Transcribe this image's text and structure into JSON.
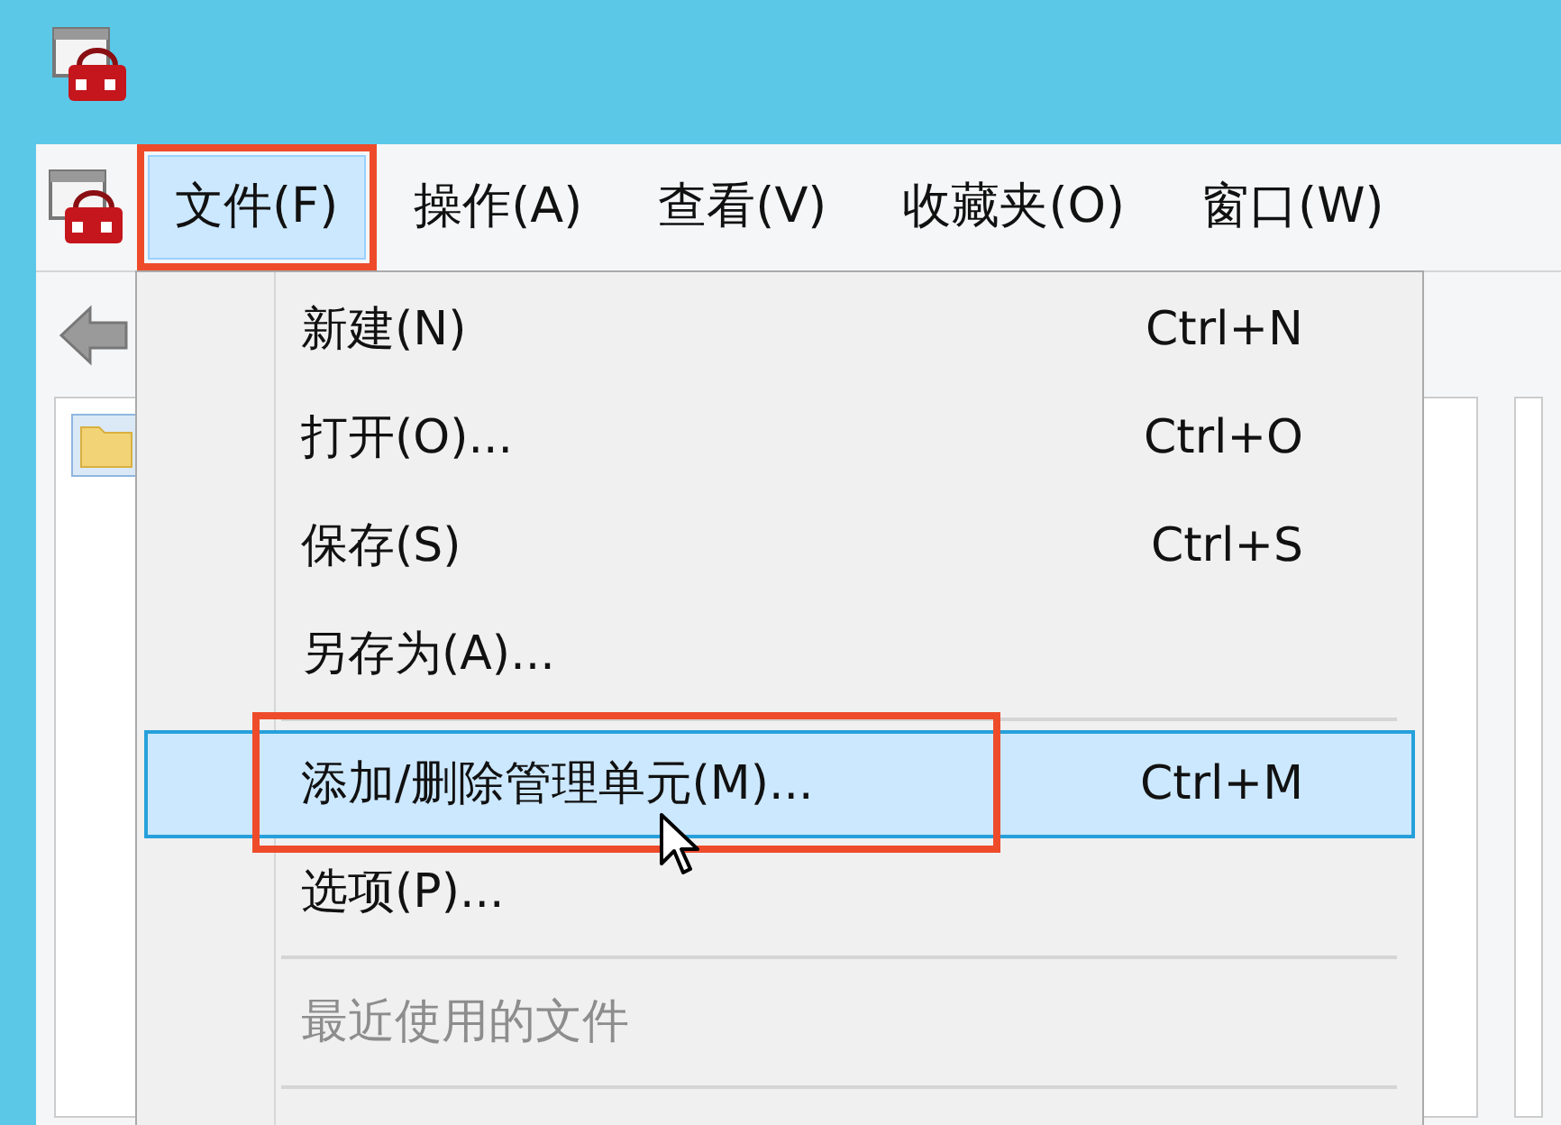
{
  "menu_bar": [
    {
      "label": "文件(F)",
      "selected": true,
      "outlined": true
    },
    {
      "label": "操作(A)",
      "selected": false,
      "outlined": false
    },
    {
      "label": "查看(V)",
      "selected": false,
      "outlined": false
    },
    {
      "label": "收藏夹(O)",
      "selected": false,
      "outlined": false
    },
    {
      "label": "窗口(W)",
      "selected": false,
      "outlined": false
    }
  ],
  "file_menu": [
    {
      "kind": "item",
      "label": "新建(N)",
      "shortcut": "Ctrl+N",
      "selected": false,
      "disabled": false,
      "outlined": false
    },
    {
      "kind": "item",
      "label": "打开(O)...",
      "shortcut": "Ctrl+O",
      "selected": false,
      "disabled": false,
      "outlined": false
    },
    {
      "kind": "item",
      "label": "保存(S)",
      "shortcut": "Ctrl+S",
      "selected": false,
      "disabled": false,
      "outlined": false
    },
    {
      "kind": "item",
      "label": "另存为(A)...",
      "selected": false,
      "disabled": false,
      "outlined": false
    },
    {
      "kind": "separator"
    },
    {
      "kind": "item",
      "label": "添加/删除管理单元(M)...",
      "shortcut": "Ctrl+M",
      "selected": true,
      "disabled": false,
      "outlined": true
    },
    {
      "kind": "item",
      "label": "选项(P)...",
      "selected": false,
      "disabled": false,
      "outlined": false
    },
    {
      "kind": "separator"
    },
    {
      "kind": "item",
      "label": "最近使用的文件",
      "selected": false,
      "disabled": true,
      "outlined": false
    },
    {
      "kind": "separator"
    }
  ]
}
